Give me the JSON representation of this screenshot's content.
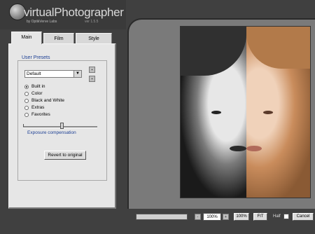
{
  "app": {
    "title": "virtualPhotographer",
    "subtitle": "by OptikVerve Labs",
    "version": "ver 1.5.5"
  },
  "tabs": [
    {
      "label": "Main",
      "active": true
    },
    {
      "label": "Film",
      "active": false
    },
    {
      "label": "Style",
      "active": false
    }
  ],
  "presets": {
    "group_title": "User Presets",
    "selected": "Default",
    "options": [
      {
        "label": "Built in",
        "checked": true
      },
      {
        "label": "Color",
        "checked": false
      },
      {
        "label": "Black and White",
        "checked": false
      },
      {
        "label": "Extras",
        "checked": false
      },
      {
        "label": "Favorites",
        "checked": false
      }
    ]
  },
  "exposure": {
    "label": "Exposure compensation",
    "value_fraction": 0.52
  },
  "buttons": {
    "revert": "Revert to original",
    "zoom_100": "100%",
    "fit": "FIT",
    "cancel": "Cancel"
  },
  "zoom": {
    "value": "100%"
  },
  "half": {
    "label": "Half"
  },
  "colors": {
    "accent_text": "#1c3f94",
    "panel_bg": "#e6e6e6",
    "window_bg": "#404040"
  }
}
